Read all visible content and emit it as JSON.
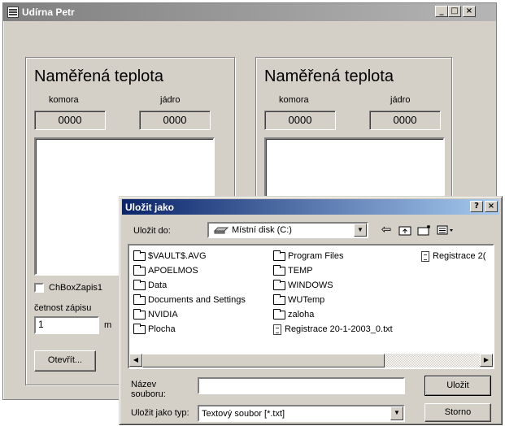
{
  "main_window": {
    "title": "Udírna Petr",
    "caption_buttons": {
      "minimize": "_",
      "maximize": "□",
      "close": "×"
    },
    "left_panel": {
      "title": "Naměřená teplota",
      "label_chamber": "komora",
      "label_core": "jádro",
      "chamber_value": "0000",
      "core_value": "0000",
      "checkbox_label": "ChBoxZapis1",
      "frequency_label": "četnost zápisu",
      "frequency_value": "1",
      "frequency_unit_partial": "m",
      "open_button": "Otevřít..."
    },
    "right_panel": {
      "title": "Naměřená teplota",
      "label_chamber": "komora",
      "label_core": "jádro",
      "chamber_value": "0000",
      "core_value": "0000"
    }
  },
  "save_dialog": {
    "title": "Uložit jako",
    "help_button": "?",
    "close_button": "×",
    "save_in_label": "Uložit do:",
    "save_in_value": "Místní disk (C:)",
    "toolbar_icons": [
      "back-icon",
      "up-folder-icon",
      "new-folder-icon",
      "view-menu-icon"
    ],
    "files": [
      {
        "name": "$VAULT$.AVG",
        "kind": "folder"
      },
      {
        "name": "APOELMOS",
        "kind": "folder"
      },
      {
        "name": "Data",
        "kind": "folder"
      },
      {
        "name": "Documents and Settings",
        "kind": "folder"
      },
      {
        "name": "NVIDIA",
        "kind": "folder"
      },
      {
        "name": "Plocha",
        "kind": "folder"
      },
      {
        "name": "Program Files",
        "kind": "folder"
      },
      {
        "name": "TEMP",
        "kind": "folder"
      },
      {
        "name": "WINDOWS",
        "kind": "folder"
      },
      {
        "name": "WUTemp",
        "kind": "folder"
      },
      {
        "name": "zaloha",
        "kind": "folder"
      },
      {
        "name": "Registrace 20-1-2003_0.txt",
        "kind": "txt"
      },
      {
        "name": "Registrace 2(",
        "kind": "txt"
      }
    ],
    "filename_label": "Název souboru:",
    "filename_value": "",
    "filetype_label": "Uložit jako typ:",
    "filetype_value": "Textový soubor [*.txt]",
    "save_button": "Uložit",
    "cancel_button": "Storno"
  }
}
